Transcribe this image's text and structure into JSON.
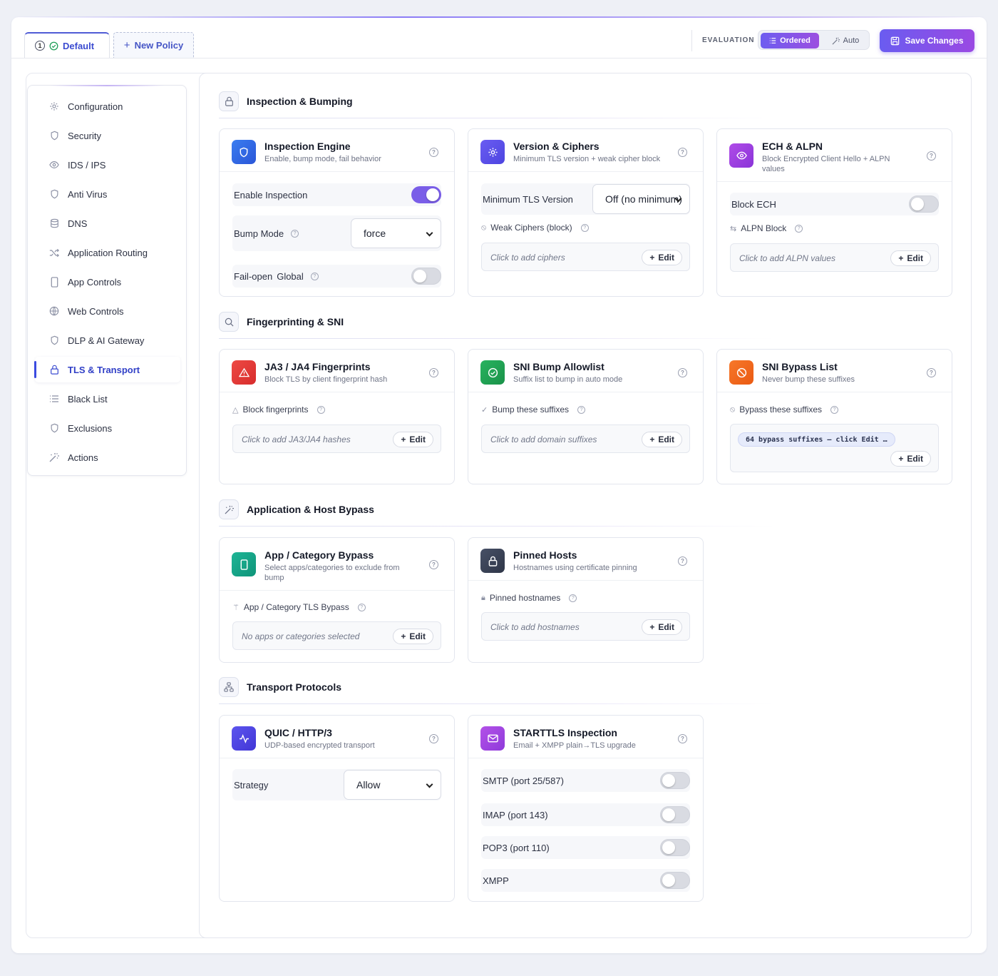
{
  "topbar": {
    "tabs": [
      {
        "number": "1",
        "label": "Default"
      },
      {
        "label": "New Policy"
      }
    ],
    "evaluation_label": "EVALUATION",
    "evaluation_modes": [
      "Ordered",
      "Auto"
    ],
    "selected_mode": "Ordered",
    "save_label": "Save Changes"
  },
  "sidebar": {
    "items": [
      {
        "label": "Configuration",
        "icon": "gear-icon"
      },
      {
        "label": "Security",
        "icon": "shield-icon"
      },
      {
        "label": "IDS / IPS",
        "icon": "eye-icon"
      },
      {
        "label": "Anti Virus",
        "icon": "shield-icon"
      },
      {
        "label": "DNS",
        "icon": "database-icon"
      },
      {
        "label": "Application Routing",
        "icon": "shuffle-icon"
      },
      {
        "label": "App Controls",
        "icon": "phone-icon"
      },
      {
        "label": "Web Controls",
        "icon": "globe-icon"
      },
      {
        "label": "DLP & AI Gateway",
        "icon": "shield-icon"
      },
      {
        "label": "TLS & Transport",
        "icon": "lock-icon"
      },
      {
        "label": "Black List",
        "icon": "list-icon"
      },
      {
        "label": "Exclusions",
        "icon": "shield-icon"
      },
      {
        "label": "Actions",
        "icon": "wand-icon"
      }
    ],
    "active": "TLS & Transport"
  },
  "sections": {
    "inspection": {
      "title": "Inspection & Bumping",
      "engine": {
        "title": "Inspection Engine",
        "subtitle": "Enable, bump mode, fail behavior",
        "enable_label": "Enable Inspection",
        "enable_on": true,
        "bump_mode_label": "Bump Mode",
        "bump_mode_value": "force",
        "failopen_label": "Fail-open",
        "failopen_scope": "Global",
        "failopen_on": false
      },
      "ciphers": {
        "title": "Version & Ciphers",
        "subtitle": "Minimum TLS version + weak cipher block",
        "min_tls_label": "Minimum TLS Version",
        "min_tls_value": "Off (no minimum)",
        "weak_label": "Weak Ciphers (block)",
        "weak_placeholder": "Click to add ciphers",
        "edit_label": "Edit"
      },
      "ech": {
        "title": "ECH & ALPN",
        "subtitle": "Block Encrypted Client Hello + ALPN values",
        "block_ech_label": "Block ECH",
        "block_ech_on": false,
        "alpn_label": "ALPN Block",
        "alpn_placeholder": "Click to add ALPN values",
        "edit_label": "Edit"
      }
    },
    "fingerprinting": {
      "title": "Fingerprinting & SNI",
      "ja3": {
        "title": "JA3 / JA4 Fingerprints",
        "subtitle": "Block TLS by client fingerprint hash",
        "field_label": "Block fingerprints",
        "placeholder": "Click to add JA3/JA4 hashes",
        "edit_label": "Edit"
      },
      "allow": {
        "title": "SNI Bump Allowlist",
        "subtitle": "Suffix list to bump in auto mode",
        "field_label": "Bump these suffixes",
        "placeholder": "Click to add domain suffixes",
        "edit_label": "Edit"
      },
      "bypass": {
        "title": "SNI Bypass List",
        "subtitle": "Never bump these suffixes",
        "field_label": "Bypass these suffixes",
        "chip": "64 bypass suffixes — click Edit …",
        "edit_label": "Edit"
      }
    },
    "app_bypass": {
      "title": "Application & Host Bypass",
      "app": {
        "title": "App / Category Bypass",
        "subtitle": "Select apps/categories to exclude from bump",
        "field_label": "App / Category TLS Bypass",
        "placeholder": "No apps or categories selected",
        "edit_label": "Edit"
      },
      "pinned": {
        "title": "Pinned Hosts",
        "subtitle": "Hostnames using certificate pinning",
        "field_label": "Pinned hostnames",
        "placeholder": "Click to add hostnames",
        "edit_label": "Edit"
      }
    },
    "transport": {
      "title": "Transport Protocols",
      "quic": {
        "title": "QUIC / HTTP/3",
        "subtitle": "UDP-based encrypted transport",
        "strategy_label": "Strategy",
        "strategy_value": "Allow"
      },
      "starttls": {
        "title": "STARTTLS Inspection",
        "subtitle": "Email + XMPP plain→TLS upgrade",
        "rows": [
          {
            "label": "SMTP (port 25/587)",
            "on": false
          },
          {
            "label": "IMAP (port 143)",
            "on": false
          },
          {
            "label": "POP3 (port 110)",
            "on": false
          },
          {
            "label": "XMPP",
            "on": false
          }
        ]
      }
    }
  },
  "colors": {
    "accent": "#6d5df0",
    "accent2": "#9b4fe0",
    "active_nav": "#3140c7",
    "icon_blue": "#2f66e6",
    "icon_indigo": "#5b4ee8",
    "icon_purple": "#9a3fe0",
    "icon_red": "#e23b3b",
    "icon_green": "#1f9d50",
    "icon_orange": "#f06a1c",
    "icon_teal": "#16a48a",
    "icon_slate": "#3b4458",
    "icon_violet": "#a348e0"
  }
}
